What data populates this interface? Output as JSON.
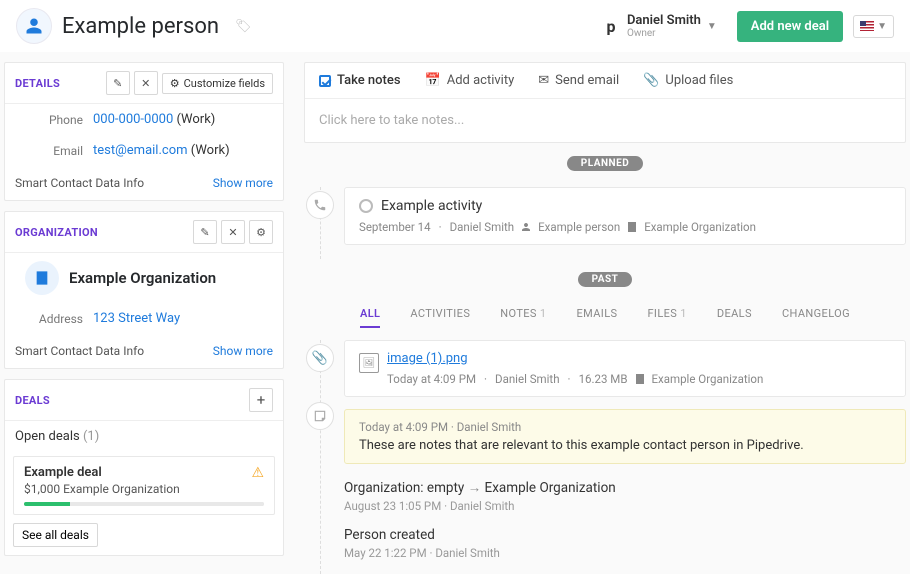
{
  "header": {
    "title": "Example person",
    "owner_name": "Daniel Smith",
    "owner_role": "Owner",
    "add_deal_label": "Add new deal"
  },
  "details": {
    "title": "DETAILS",
    "customize_label": "Customize fields",
    "phone_label": "Phone",
    "phone_value": "000-000-0000",
    "phone_qual": "(Work)",
    "email_label": "Email",
    "email_value": "test@email.com",
    "email_qual": "(Work)",
    "smart_label": "Smart Contact Data Info",
    "show_more": "Show more"
  },
  "org": {
    "title": "ORGANIZATION",
    "name": "Example Organization",
    "address_label": "Address",
    "address_value": "123 Street Way",
    "smart_label": "Smart Contact Data Info",
    "show_more": "Show more"
  },
  "deals": {
    "title": "DEALS",
    "open_label": "Open deals",
    "open_count": "(1)",
    "deal_name": "Example deal",
    "deal_amount": "$1,000",
    "deal_org": "Example Organization",
    "see_all": "See all deals"
  },
  "compose": {
    "tab_notes": "Take notes",
    "tab_activity": "Add activity",
    "tab_email": "Send email",
    "tab_files": "Upload files",
    "placeholder": "Click here to take notes..."
  },
  "pills": {
    "planned": "PLANNED",
    "past": "PAST"
  },
  "activity": {
    "title": "Example activity",
    "date": "September 14",
    "owner": "Daniel Smith",
    "person": "Example person",
    "org": "Example Organization"
  },
  "filters": {
    "all": "ALL",
    "activities": "ACTIVITIES",
    "notes": "NOTES",
    "notes_count": "1",
    "emails": "EMAILS",
    "files": "FILES",
    "files_count": "1",
    "deals": "DEALS",
    "changelog": "CHANGELOG"
  },
  "file": {
    "name": "image (1).png",
    "time": "Today at 4:09 PM",
    "owner": "Daniel Smith",
    "size": "16.23 MB",
    "org": "Example Organization"
  },
  "note": {
    "time": "Today at 4:09 PM",
    "owner": "Daniel Smith",
    "body": "These are notes that are relevant to this example contact person in Pipedrive."
  },
  "changes": {
    "org_title_prefix": "Organization: empty",
    "org_title_suffix": "Example Organization",
    "org_time": "August 23 1:05 PM",
    "org_owner": "Daniel Smith",
    "created_title": "Person created",
    "created_time": "May 22 1:22 PM",
    "created_owner": "Daniel Smith"
  }
}
